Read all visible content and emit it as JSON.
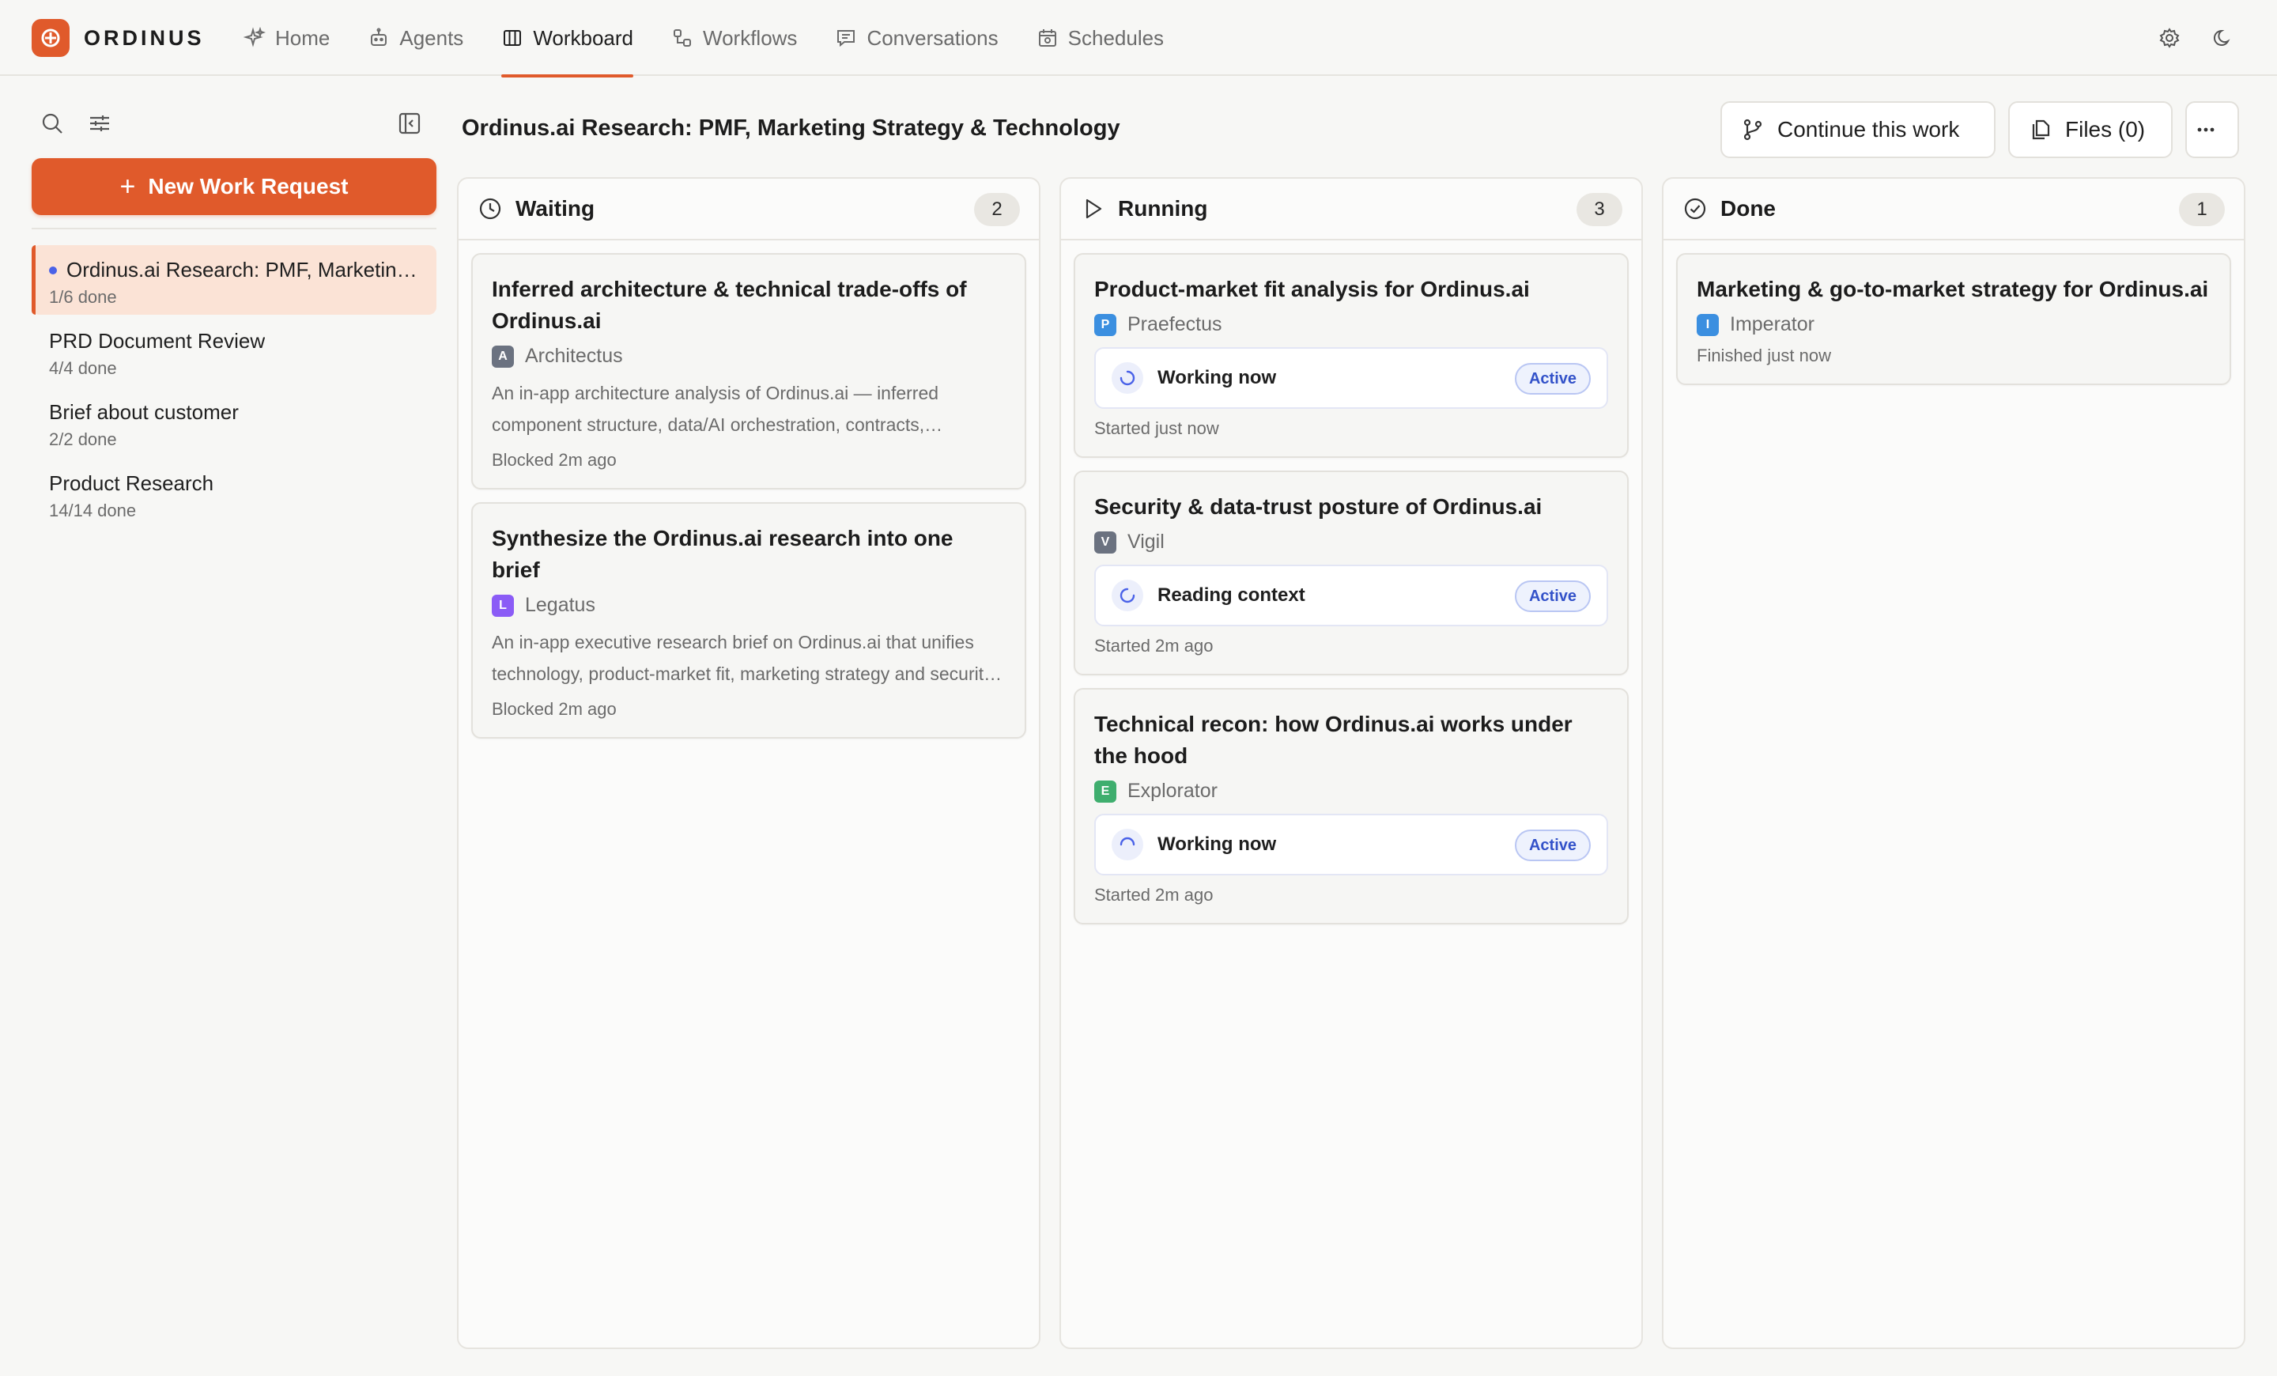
{
  "brand": {
    "name": "ORDINUS"
  },
  "nav": {
    "items": [
      {
        "label": "Home",
        "icon": "sparkle-icon"
      },
      {
        "label": "Agents",
        "icon": "robot-icon"
      },
      {
        "label": "Workboard",
        "icon": "board-icon",
        "active": true
      },
      {
        "label": "Workflows",
        "icon": "workflow-icon"
      },
      {
        "label": "Conversations",
        "icon": "chat-icon"
      },
      {
        "label": "Schedules",
        "icon": "calendar-icon"
      }
    ]
  },
  "sidebar": {
    "new_request_label": "New Work Request",
    "items": [
      {
        "title": "Ordinus.ai Research: PMF, Marketing Strategy & Technology",
        "progress": "1/6 done",
        "active": true
      },
      {
        "title": "PRD Document Review",
        "progress": "4/4 done"
      },
      {
        "title": "Brief about customer",
        "progress": "2/2 done"
      },
      {
        "title": "Product Research",
        "progress": "14/14 done"
      }
    ]
  },
  "main": {
    "title": "Ordinus.ai Research: PMF, Marketing Strategy & Technology",
    "continue_label": "Continue this work",
    "files_label": "Files (0)",
    "more_label": "···"
  },
  "columns": {
    "waiting": {
      "title": "Waiting",
      "count": "2",
      "cards": [
        {
          "title": "Inferred architecture & technical trade-offs of Ordinus.ai",
          "agent": "Architectus",
          "agent_initial": "A",
          "description": "An in-app architecture analysis of Ordinus.ai — inferred component structure, data/AI orchestration, contracts, integrations and technical trade-offs.",
          "meta": "Blocked 2m ago"
        },
        {
          "title": "Synthesize the Ordinus.ai research into one brief",
          "agent": "Legatus",
          "agent_initial": "L",
          "description": "An in-app executive research brief on Ordinus.ai that unifies technology, product-market fit, marketing strategy and security findings.",
          "meta": "Blocked 2m ago"
        }
      ]
    },
    "running": {
      "title": "Running",
      "count": "3",
      "cards": [
        {
          "title": "Product-market fit analysis for Ordinus.ai",
          "agent": "Praefectus",
          "agent_initial": "P",
          "status": "Working now",
          "pill": "Active",
          "meta": "Started just now"
        },
        {
          "title": "Security & data-trust posture of Ordinus.ai",
          "agent": "Vigil",
          "agent_initial": "V",
          "status": "Reading context",
          "pill": "Active",
          "meta": "Started 2m ago"
        },
        {
          "title": "Technical recon: how Ordinus.ai works under the hood",
          "agent": "Explorator",
          "agent_initial": "E",
          "status": "Working now",
          "pill": "Active",
          "meta": "Started 2m ago"
        }
      ]
    },
    "done": {
      "title": "Done",
      "count": "1",
      "cards": [
        {
          "title": "Marketing & go-to-market strategy for Ordinus.ai",
          "agent": "Imperator",
          "agent_initial": "I",
          "meta": "Finished just now"
        }
      ]
    }
  },
  "colors": {
    "accent": "#e05a2b",
    "agent_architectus": "#6b7280",
    "agent_legatus": "#8b5cf6",
    "agent_praefectus": "#3b8fe0",
    "agent_vigil": "#6b7280",
    "agent_explorator": "#3fae6e",
    "agent_imperator": "#3b8fe0",
    "active_pill": "#3352c9"
  }
}
